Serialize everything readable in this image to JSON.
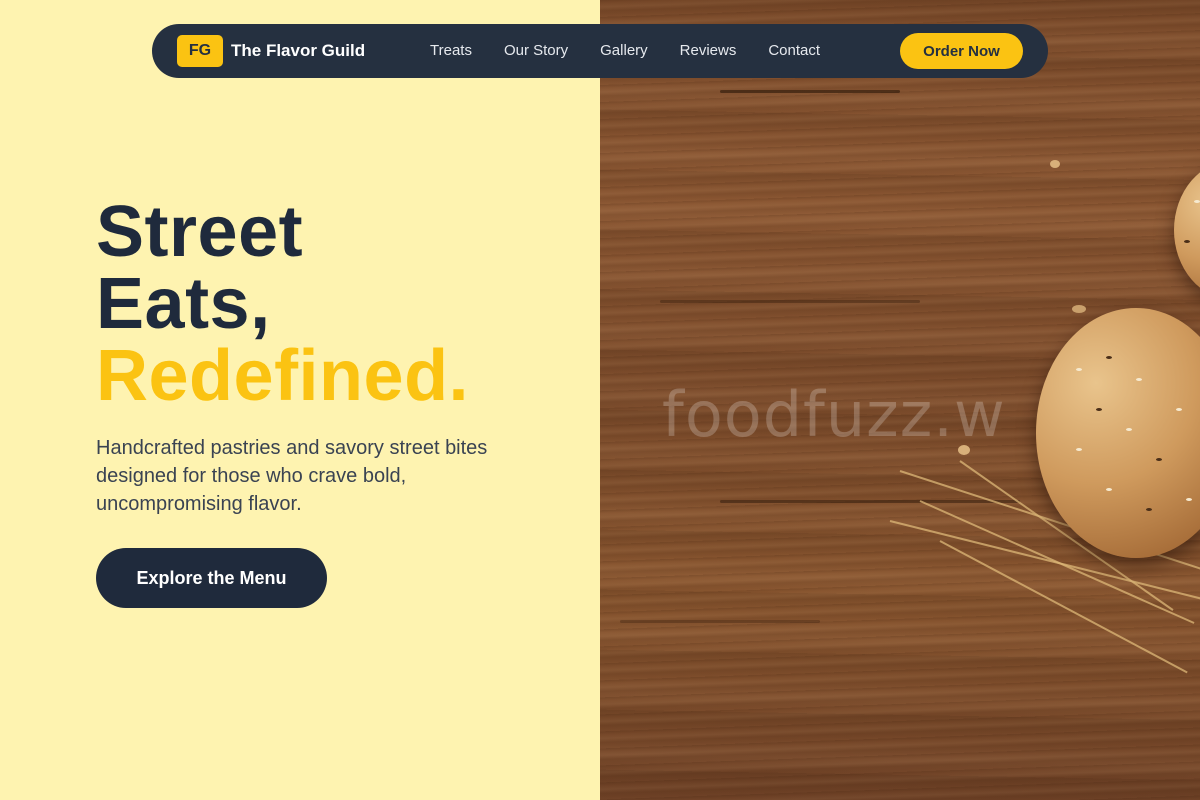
{
  "nav": {
    "logo_badge": "FG",
    "brand": "The Flavor Guild",
    "links": [
      "Treats",
      "Our Story",
      "Gallery",
      "Reviews",
      "Contact"
    ],
    "cta": "Order Now"
  },
  "hero": {
    "headline_line1": "Street",
    "headline_line2": "Eats,",
    "headline_accent": "Redefined.",
    "subtext": "Handcrafted pastries and savory street bites designed for those who crave bold, uncompromising flavor.",
    "cta": "Explore the Menu"
  },
  "image": {
    "watermark": "foodfuzz.w"
  },
  "colors": {
    "background_left": "#fef3b0",
    "nav_background": "#253040",
    "accent_yellow": "#fbc312",
    "headline_dark": "#1f2a3c",
    "cta_dark": "#1f2a3c"
  }
}
